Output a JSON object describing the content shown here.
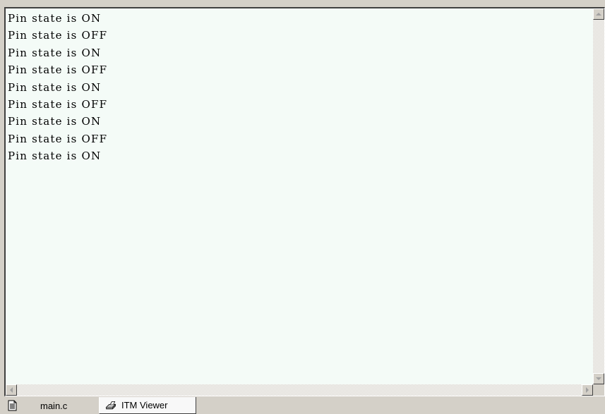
{
  "output_window": {
    "lines": [
      "Pin state is ON",
      "Pin state is OFF",
      "Pin state is ON",
      "Pin state is OFF",
      "Pin state is ON",
      "Pin state is OFF",
      "Pin state is ON",
      "Pin state is OFF",
      "Pin state is ON"
    ]
  },
  "tabs": [
    {
      "label": "main.c",
      "icon": "document-icon",
      "active": false
    },
    {
      "label": "ITM Viewer",
      "icon": "printer-icon",
      "active": true
    }
  ],
  "colors": {
    "output_background": "#f4fbf7",
    "chrome": "#d4d0c8"
  }
}
